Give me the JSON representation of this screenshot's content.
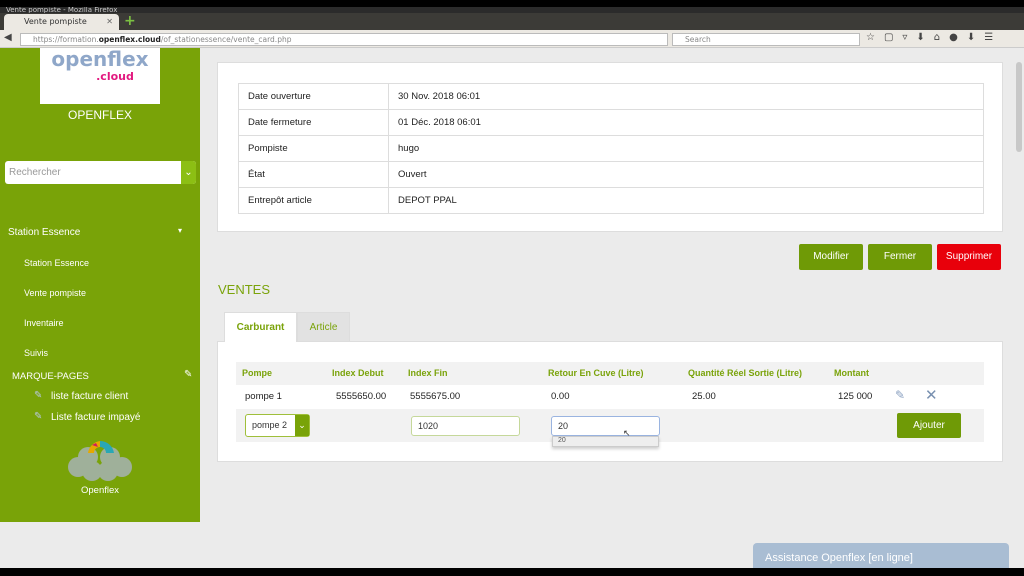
{
  "browser": {
    "window_title": "Vente pompiste - Mozilla Firefox",
    "tab_title": "Vente pompiste",
    "url_prefix": "https://formation.",
    "url_domain": "openflex.cloud",
    "url_path": "/of_stationessence/vente_card.php",
    "search_placeholder": "Search"
  },
  "sidebar": {
    "logo_text": "openflex",
    "logo_sub": ".cloud",
    "brand": "OPENFLEX",
    "search_placeholder": "Rechercher",
    "section": "Station Essence",
    "items": [
      {
        "label": "Station Essence"
      },
      {
        "label": "Vente pompiste"
      },
      {
        "label": "Inventaire"
      },
      {
        "label": "Suivis"
      }
    ],
    "bookmarks_title": "MARQUE-PAGES",
    "bookmarks": [
      {
        "label": "liste facture client"
      },
      {
        "label": "Liste facture impayé"
      }
    ],
    "footer_logo": "Openflex"
  },
  "info": [
    {
      "label": "Date ouverture",
      "value": "30 Nov. 2018 06:01"
    },
    {
      "label": "Date fermeture",
      "value": "01 Déc. 2018 06:01"
    },
    {
      "label": "Pompiste",
      "value": "hugo"
    },
    {
      "label": "État",
      "value": "Ouvert"
    },
    {
      "label": "Entrepôt article",
      "value": "DEPOT PPAL"
    }
  ],
  "actions": {
    "modify": "Modifier",
    "close": "Fermer",
    "delete": "Supprimer",
    "delete_color": "#e8000b",
    "accent": "#79a308"
  },
  "ventes": {
    "title": "VENTES",
    "tabs": [
      {
        "label": "Carburant",
        "active": true
      },
      {
        "label": "Article",
        "active": false
      }
    ],
    "columns": [
      "Pompe",
      "Index Debut",
      "Index Fin",
      "Retour En Cuve (Litre)",
      "Quantité Réel Sortie (Litre)",
      "Montant"
    ],
    "rows": [
      {
        "pompe": "pompe 1",
        "index_debut": "5555650.00",
        "index_fin": "5555675.00",
        "retour": "0.00",
        "quantite": "25.00",
        "montant": "125 000"
      }
    ],
    "new_row": {
      "pompe": "pompe 2",
      "index_fin": "1020",
      "retour": "20",
      "autocomplete": "20",
      "add": "Ajouter"
    }
  },
  "chat": {
    "label": "Assistance Openflex [en ligne]"
  }
}
